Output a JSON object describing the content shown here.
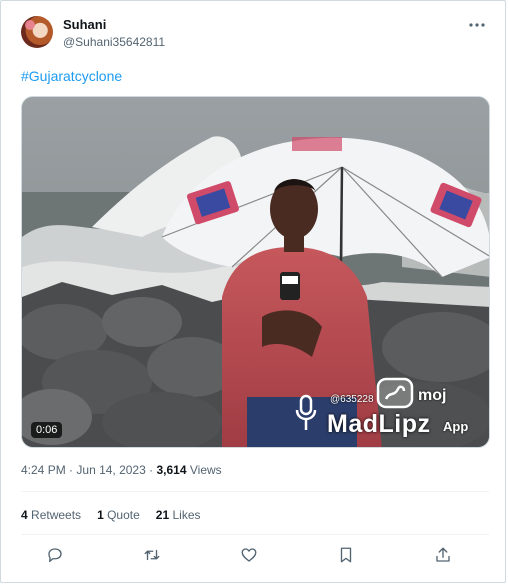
{
  "tweet": {
    "display_name": "Suhani",
    "handle": "@Suhani35642811",
    "hashtag": "#Gujaratcyclone",
    "video_duration": "0:06",
    "time": "4:24 PM",
    "date": "Jun 14, 2023",
    "views_count": "3,614",
    "views_label": "Views",
    "stats": {
      "retweets_count": "4",
      "retweets_label": "Retweets",
      "quotes_count": "1",
      "quotes_label": "Quote",
      "likes_count": "21",
      "likes_label": "Likes"
    }
  },
  "watermark": {
    "handle": "@635228",
    "moj": "moj",
    "madlipz": "MadLipz",
    "app": "App"
  },
  "icons": {
    "more": "more-icon",
    "reply": "reply-icon",
    "retweet": "retweet-icon",
    "like": "like-icon",
    "bookmark": "bookmark-icon",
    "share": "share-icon"
  },
  "colors": {
    "link": "#1d9bf0",
    "secondary_text": "#536471",
    "border": "#cfd9de"
  }
}
